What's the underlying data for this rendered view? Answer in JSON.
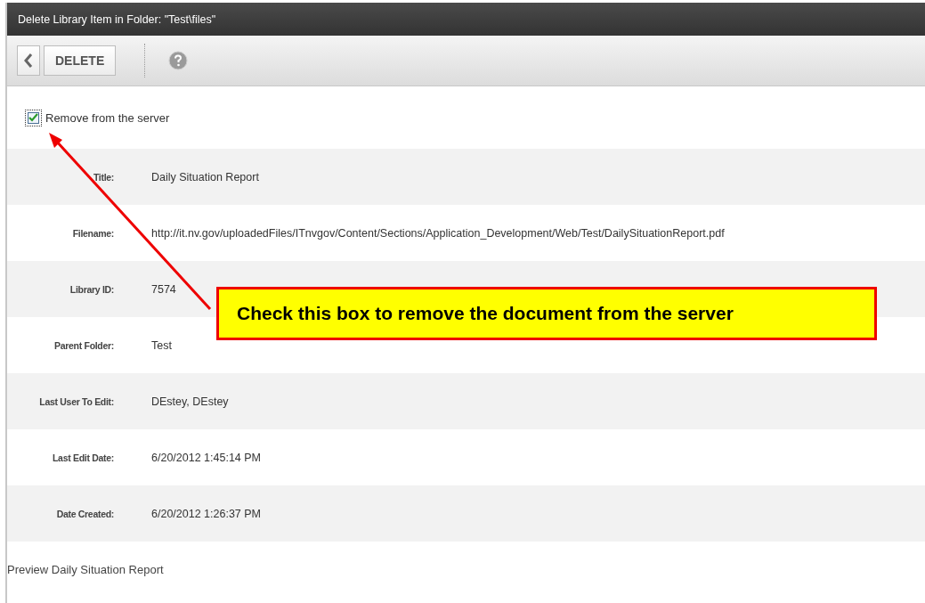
{
  "window": {
    "title": "Delete Library Item in Folder: \"Test\\files\""
  },
  "toolbar": {
    "delete_label": "DELETE"
  },
  "remove_option": {
    "label": "Remove from the server",
    "checked": true
  },
  "fields": [
    {
      "label": "Title:",
      "value": "Daily Situation Report"
    },
    {
      "label": "Filename:",
      "value": "http://it.nv.gov/uploadedFiles/ITnvgov/Content/Sections/Application_Development/Web/Test/DailySituationReport.pdf"
    },
    {
      "label": "Library ID:",
      "value": "7574"
    },
    {
      "label": "Parent Folder:",
      "value": "Test"
    },
    {
      "label": "Last User To Edit:",
      "value": "DEstey, DEstey"
    },
    {
      "label": "Last Edit Date:",
      "value": "6/20/2012 1:45:14 PM"
    },
    {
      "label": "Date Created:",
      "value": "6/20/2012 1:26:37 PM"
    }
  ],
  "preview_link": "Preview Daily Situation Report",
  "callout": {
    "text": "Check this box to remove the document from the server"
  }
}
